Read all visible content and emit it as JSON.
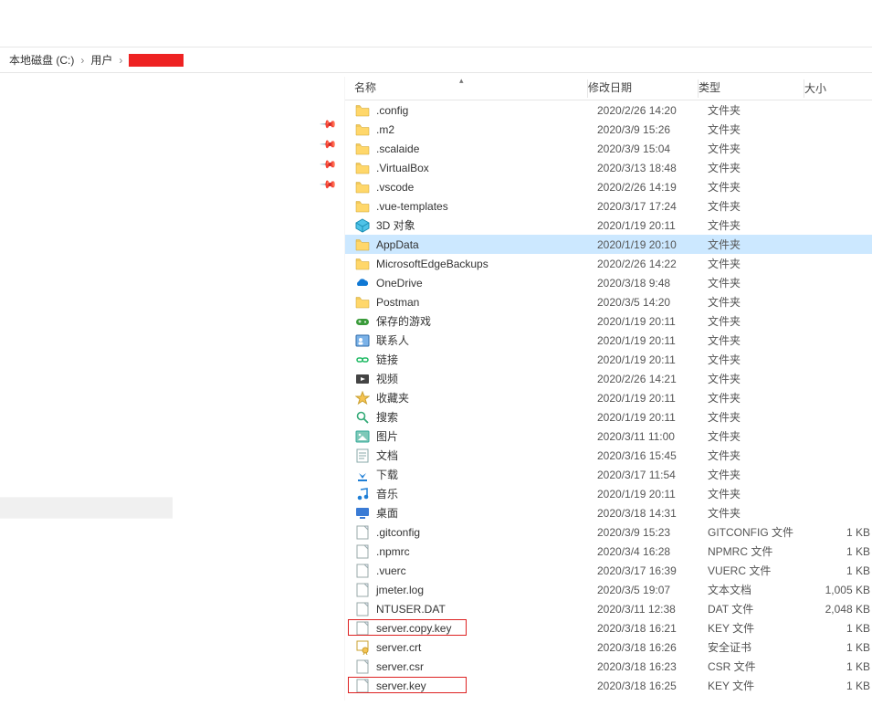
{
  "breadcrumb": {
    "items": [
      "本地磁盘 (C:)",
      "用户",
      "[redacted]"
    ]
  },
  "columns": {
    "name": "名称",
    "date": "修改日期",
    "type": "类型",
    "size": "大小"
  },
  "rows": [
    {
      "icon": "folder",
      "name": ".config",
      "date": "2020/2/26 14:20",
      "type": "文件夹",
      "size": ""
    },
    {
      "icon": "folder",
      "name": ".m2",
      "date": "2020/3/9 15:26",
      "type": "文件夹",
      "size": ""
    },
    {
      "icon": "folder",
      "name": ".scalaide",
      "date": "2020/3/9 15:04",
      "type": "文件夹",
      "size": ""
    },
    {
      "icon": "folder",
      "name": ".VirtualBox",
      "date": "2020/3/13 18:48",
      "type": "文件夹",
      "size": ""
    },
    {
      "icon": "folder",
      "name": ".vscode",
      "date": "2020/2/26 14:19",
      "type": "文件夹",
      "size": ""
    },
    {
      "icon": "folder",
      "name": ".vue-templates",
      "date": "2020/3/17 17:24",
      "type": "文件夹",
      "size": ""
    },
    {
      "icon": "3d",
      "name": "3D 对象",
      "date": "2020/1/19 20:11",
      "type": "文件夹",
      "size": ""
    },
    {
      "icon": "folder",
      "name": "AppData",
      "date": "2020/1/19 20:10",
      "type": "文件夹",
      "size": "",
      "selected": true
    },
    {
      "icon": "folder",
      "name": "MicrosoftEdgeBackups",
      "date": "2020/2/26 14:22",
      "type": "文件夹",
      "size": ""
    },
    {
      "icon": "onedrive",
      "name": "OneDrive",
      "date": "2020/3/18 9:48",
      "type": "文件夹",
      "size": ""
    },
    {
      "icon": "folder",
      "name": "Postman",
      "date": "2020/3/5 14:20",
      "type": "文件夹",
      "size": ""
    },
    {
      "icon": "gamepad",
      "name": "保存的游戏",
      "date": "2020/1/19 20:11",
      "type": "文件夹",
      "size": ""
    },
    {
      "icon": "contacts",
      "name": "联系人",
      "date": "2020/1/19 20:11",
      "type": "文件夹",
      "size": ""
    },
    {
      "icon": "link",
      "name": "链接",
      "date": "2020/1/19 20:11",
      "type": "文件夹",
      "size": ""
    },
    {
      "icon": "video",
      "name": "视频",
      "date": "2020/2/26 14:21",
      "type": "文件夹",
      "size": ""
    },
    {
      "icon": "star",
      "name": "收藏夹",
      "date": "2020/1/19 20:11",
      "type": "文件夹",
      "size": ""
    },
    {
      "icon": "search",
      "name": "搜索",
      "date": "2020/1/19 20:11",
      "type": "文件夹",
      "size": ""
    },
    {
      "icon": "image",
      "name": "图片",
      "date": "2020/3/11 11:00",
      "type": "文件夹",
      "size": ""
    },
    {
      "icon": "doc",
      "name": "文档",
      "date": "2020/3/16 15:45",
      "type": "文件夹",
      "size": ""
    },
    {
      "icon": "download",
      "name": "下载",
      "date": "2020/3/17 11:54",
      "type": "文件夹",
      "size": ""
    },
    {
      "icon": "music",
      "name": "音乐",
      "date": "2020/1/19 20:11",
      "type": "文件夹",
      "size": ""
    },
    {
      "icon": "desktop",
      "name": "桌面",
      "date": "2020/3/18 14:31",
      "type": "文件夹",
      "size": ""
    },
    {
      "icon": "file",
      "name": ".gitconfig",
      "date": "2020/3/9 15:23",
      "type": "GITCONFIG 文件",
      "size": "1 KB"
    },
    {
      "icon": "file",
      "name": ".npmrc",
      "date": "2020/3/4 16:28",
      "type": "NPMRC 文件",
      "size": "1 KB"
    },
    {
      "icon": "file",
      "name": ".vuerc",
      "date": "2020/3/17 16:39",
      "type": "VUERC 文件",
      "size": "1 KB"
    },
    {
      "icon": "textfile",
      "name": "jmeter.log",
      "date": "2020/3/5 19:07",
      "type": "文本文档",
      "size": "1,005 KB"
    },
    {
      "icon": "file",
      "name": "NTUSER.DAT",
      "date": "2020/3/11 12:38",
      "type": "DAT 文件",
      "size": "2,048 KB"
    },
    {
      "icon": "file",
      "name": "server.copy.key",
      "date": "2020/3/18 16:21",
      "type": "KEY 文件",
      "size": "1 KB",
      "highlight": true
    },
    {
      "icon": "cert",
      "name": "server.crt",
      "date": "2020/3/18 16:26",
      "type": "安全证书",
      "size": "1 KB"
    },
    {
      "icon": "file",
      "name": "server.csr",
      "date": "2020/3/18 16:23",
      "type": "CSR 文件",
      "size": "1 KB"
    },
    {
      "icon": "file",
      "name": "server.key",
      "date": "2020/3/18 16:25",
      "type": "KEY 文件",
      "size": "1 KB",
      "highlight": true
    }
  ]
}
